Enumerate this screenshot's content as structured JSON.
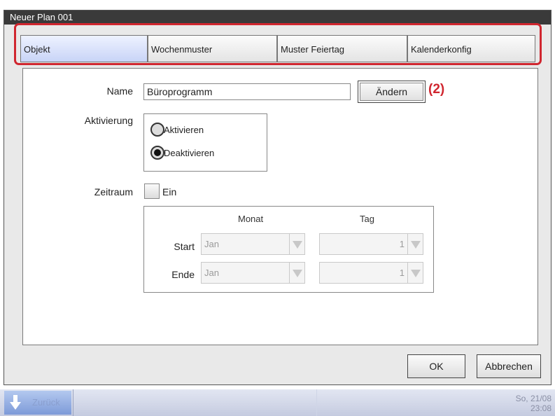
{
  "window": {
    "title": "Neuer Plan 001"
  },
  "tabs": [
    {
      "label": "Objekt",
      "active": true
    },
    {
      "label": "Wochenmuster",
      "active": false
    },
    {
      "label": "Muster Feiertag",
      "active": false
    },
    {
      "label": "Kalenderkonfig",
      "active": false
    }
  ],
  "form": {
    "name_label": "Name",
    "name_value": "Büroprogramm",
    "change_button": "Ändern",
    "callout": "(2)",
    "activation_label": "Aktivierung",
    "activation_options": [
      {
        "label": "Aktivieren",
        "selected": false
      },
      {
        "label": "Deaktivieren",
        "selected": true
      }
    ],
    "period_label": "Zeitraum",
    "period_checkbox_label": "Ein",
    "period_checked": false,
    "period": {
      "month_header": "Monat",
      "day_header": "Tag",
      "start_label": "Start",
      "end_label": "Ende",
      "start_month": "Jan",
      "start_day": "1",
      "end_month": "Jan",
      "end_day": "1"
    }
  },
  "footer": {
    "ok": "OK",
    "cancel": "Abbrechen"
  },
  "statusbar": {
    "back": "Zurück",
    "date": "So, 21/08",
    "time": "23:08"
  },
  "colors": {
    "highlight": "#d0262f",
    "active_tab": "#c8d4f7",
    "titlebar": "#3a3a3a"
  }
}
